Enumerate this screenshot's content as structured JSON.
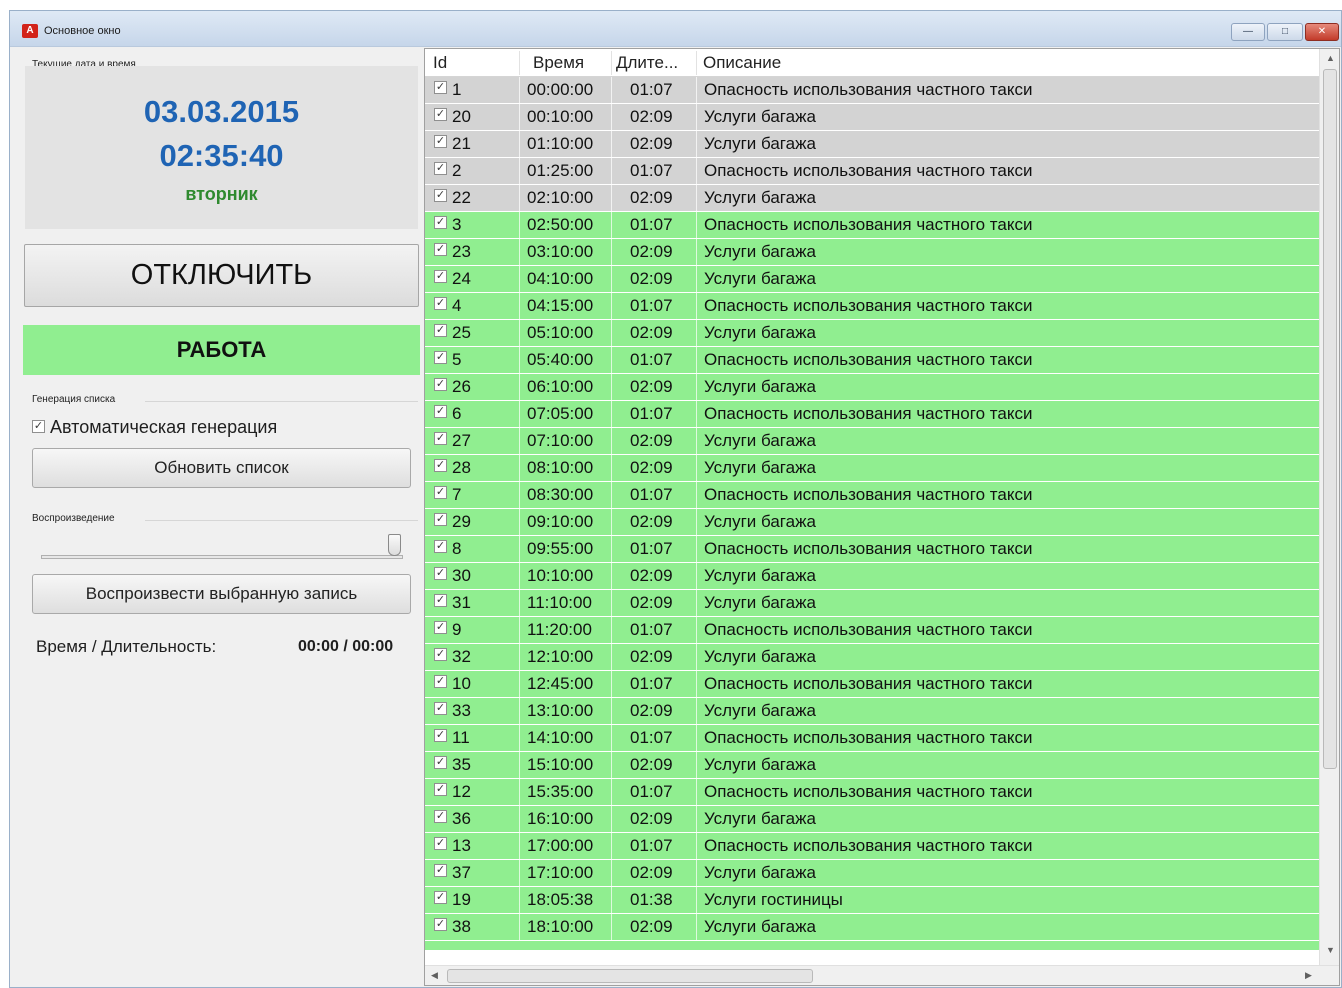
{
  "window": {
    "title": "Основное окно",
    "app_icon": "A",
    "min_label": "—",
    "max_label": "□",
    "close_label": "✕"
  },
  "left_panel": {
    "datetime_group_label": "Текущие дата и время",
    "date": "03.03.2015",
    "time": "02:35:40",
    "weekday": "вторник",
    "disable_button": "ОТКЛЮЧИТЬ",
    "status": "РАБОТА",
    "generation_group_label": "Генерация списка",
    "auto_generation_label": "Автоматическая генерация",
    "auto_generation_checked": true,
    "refresh_button": "Обновить список",
    "playback_group_label": "Воспроизведение",
    "playback_position": 1.0,
    "play_button": "Воспроизвести выбранную запись",
    "time_duration_label": "Время / Длительность:",
    "time_duration_value": "00:00 / 00:00"
  },
  "grid": {
    "columns": [
      "Id",
      "Время",
      "Длите...",
      "Описание"
    ],
    "rows": [
      {
        "id": "1",
        "time": "00:00:00",
        "dur": "01:07",
        "desc": "Опасность использования частного такси",
        "state": "gray"
      },
      {
        "id": "20",
        "time": "00:10:00",
        "dur": "02:09",
        "desc": "Услуги багажа",
        "state": "gray"
      },
      {
        "id": "21",
        "time": "01:10:00",
        "dur": "02:09",
        "desc": "Услуги багажа",
        "state": "gray"
      },
      {
        "id": "2",
        "time": "01:25:00",
        "dur": "01:07",
        "desc": "Опасность использования частного такси",
        "state": "gray"
      },
      {
        "id": "22",
        "time": "02:10:00",
        "dur": "02:09",
        "desc": "Услуги багажа",
        "state": "gray"
      },
      {
        "id": "3",
        "time": "02:50:00",
        "dur": "01:07",
        "desc": "Опасность использования частного такси",
        "state": "green"
      },
      {
        "id": "23",
        "time": "03:10:00",
        "dur": "02:09",
        "desc": "Услуги багажа",
        "state": "green"
      },
      {
        "id": "24",
        "time": "04:10:00",
        "dur": "02:09",
        "desc": "Услуги багажа",
        "state": "green"
      },
      {
        "id": "4",
        "time": "04:15:00",
        "dur": "01:07",
        "desc": "Опасность использования частного такси",
        "state": "green"
      },
      {
        "id": "25",
        "time": "05:10:00",
        "dur": "02:09",
        "desc": "Услуги багажа",
        "state": "green"
      },
      {
        "id": "5",
        "time": "05:40:00",
        "dur": "01:07",
        "desc": "Опасность использования частного такси",
        "state": "green"
      },
      {
        "id": "26",
        "time": "06:10:00",
        "dur": "02:09",
        "desc": "Услуги багажа",
        "state": "green"
      },
      {
        "id": "6",
        "time": "07:05:00",
        "dur": "01:07",
        "desc": "Опасность использования частного такси",
        "state": "green"
      },
      {
        "id": "27",
        "time": "07:10:00",
        "dur": "02:09",
        "desc": "Услуги багажа",
        "state": "green"
      },
      {
        "id": "28",
        "time": "08:10:00",
        "dur": "02:09",
        "desc": "Услуги багажа",
        "state": "green"
      },
      {
        "id": "7",
        "time": "08:30:00",
        "dur": "01:07",
        "desc": "Опасность использования частного такси",
        "state": "green"
      },
      {
        "id": "29",
        "time": "09:10:00",
        "dur": "02:09",
        "desc": "Услуги багажа",
        "state": "green"
      },
      {
        "id": "8",
        "time": "09:55:00",
        "dur": "01:07",
        "desc": "Опасность использования частного такси",
        "state": "green"
      },
      {
        "id": "30",
        "time": "10:10:00",
        "dur": "02:09",
        "desc": "Услуги багажа",
        "state": "green"
      },
      {
        "id": "31",
        "time": "11:10:00",
        "dur": "02:09",
        "desc": "Услуги багажа",
        "state": "green"
      },
      {
        "id": "9",
        "time": "11:20:00",
        "dur": "01:07",
        "desc": "Опасность использования частного такси",
        "state": "green"
      },
      {
        "id": "32",
        "time": "12:10:00",
        "dur": "02:09",
        "desc": "Услуги багажа",
        "state": "green"
      },
      {
        "id": "10",
        "time": "12:45:00",
        "dur": "01:07",
        "desc": "Опасность использования частного такси",
        "state": "green"
      },
      {
        "id": "33",
        "time": "13:10:00",
        "dur": "02:09",
        "desc": "Услуги багажа",
        "state": "green"
      },
      {
        "id": "11",
        "time": "14:10:00",
        "dur": "01:07",
        "desc": "Опасность использования частного такси",
        "state": "green"
      },
      {
        "id": "35",
        "time": "15:10:00",
        "dur": "02:09",
        "desc": "Услуги багажа",
        "state": "green"
      },
      {
        "id": "12",
        "time": "15:35:00",
        "dur": "01:07",
        "desc": "Опасность использования частного такси",
        "state": "green"
      },
      {
        "id": "36",
        "time": "16:10:00",
        "dur": "02:09",
        "desc": "Услуги багажа",
        "state": "green"
      },
      {
        "id": "13",
        "time": "17:00:00",
        "dur": "01:07",
        "desc": "Опасность использования частного такси",
        "state": "green"
      },
      {
        "id": "37",
        "time": "17:10:00",
        "dur": "02:09",
        "desc": "Услуги багажа",
        "state": "green"
      },
      {
        "id": "19",
        "time": "18:05:38",
        "dur": "01:38",
        "desc": "Услуги гостиницы",
        "state": "green"
      },
      {
        "id": "38",
        "time": "18:10:00",
        "dur": "02:09",
        "desc": "Услуги багажа",
        "state": "green"
      }
    ],
    "check_glyph": "✓"
  },
  "colors": {
    "gray_row": "#d3d3d3",
    "green_row": "#90ee90",
    "clock_blue": "#1f64b4",
    "weekday_green": "#2f8a2f"
  }
}
